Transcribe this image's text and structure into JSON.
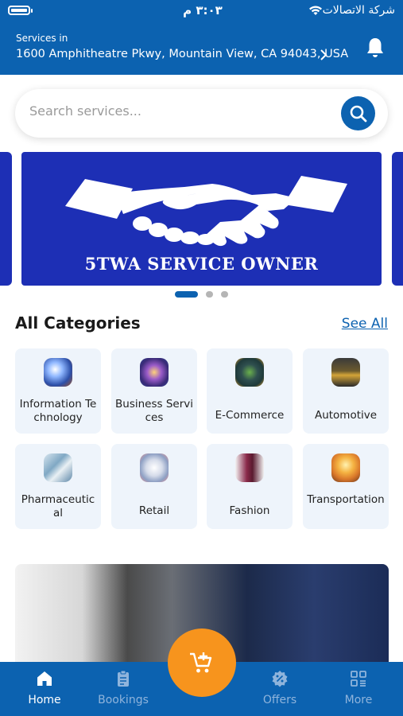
{
  "status_bar": {
    "time": "٣:٠٣ م",
    "carrier": "شركة الاتصالات"
  },
  "header": {
    "services_in_label": "Services in",
    "address": "1600 Amphitheatre Pkwy, Mountain View, CA 94043, USA"
  },
  "search": {
    "placeholder": "Search services..."
  },
  "banner": {
    "caption": "5TWA SERVICE OWNER",
    "slides_count": 3,
    "active_slide": 1
  },
  "categories": {
    "title": "All Categories",
    "see_all_label": "See All",
    "items": [
      {
        "label": "Information Technology"
      },
      {
        "label": "Business Services"
      },
      {
        "label": "E-Commerce"
      },
      {
        "label": "Automotive"
      },
      {
        "label": "Pharmaceutical"
      },
      {
        "label": "Retail"
      },
      {
        "label": "Fashion"
      },
      {
        "label": "Transportation"
      }
    ]
  },
  "bottom_nav": {
    "items": [
      {
        "label": "Home",
        "icon": "home-icon",
        "active": true
      },
      {
        "label": "Bookings",
        "icon": "clipboard-icon",
        "active": false
      },
      {
        "label": "Offers",
        "icon": "badge-percent-icon",
        "active": false
      },
      {
        "label": "More",
        "icon": "grid-icon",
        "active": false
      }
    ],
    "fab_icon": "add-to-cart-icon"
  },
  "colors": {
    "primary": "#0c62b0",
    "accent": "#f7941d",
    "banner": "#1d2fb5",
    "tile_background": "#eef4fb"
  }
}
